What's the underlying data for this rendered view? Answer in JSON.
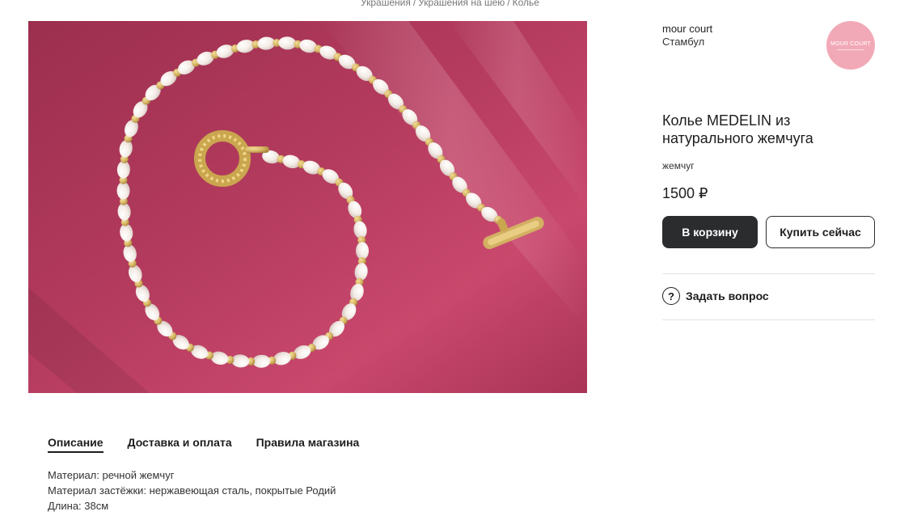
{
  "breadcrumb": {
    "items": [
      "Украшения",
      "Украшения на шею",
      "Колье"
    ],
    "separator": "/"
  },
  "seller": {
    "name": "mour court",
    "city": "Стамбул",
    "logo_text": "MOUR COURT",
    "logo_color": "#f2a9b7"
  },
  "product": {
    "title": "Колье MEDELIN из натурального жемчуга",
    "tag": "жемчуг",
    "price": "1500 ₽"
  },
  "buttons": {
    "cart": "В корзину",
    "buy_now": "Купить сейчас",
    "ask": "Задать вопрос",
    "ask_icon": "?"
  },
  "tabs": [
    {
      "label": "Описание",
      "active": true
    },
    {
      "label": "Доставка и оплата",
      "active": false
    },
    {
      "label": "Правила магазина",
      "active": false
    }
  ],
  "description": [
    "Материал: речной жемчуг",
    "Материал застёжки: нержавеющая сталь, покрытые Родий",
    "Длина: 38см"
  ],
  "colors": {
    "photo_background": "#b03a5b",
    "primary_button": "#2a2c2e"
  }
}
